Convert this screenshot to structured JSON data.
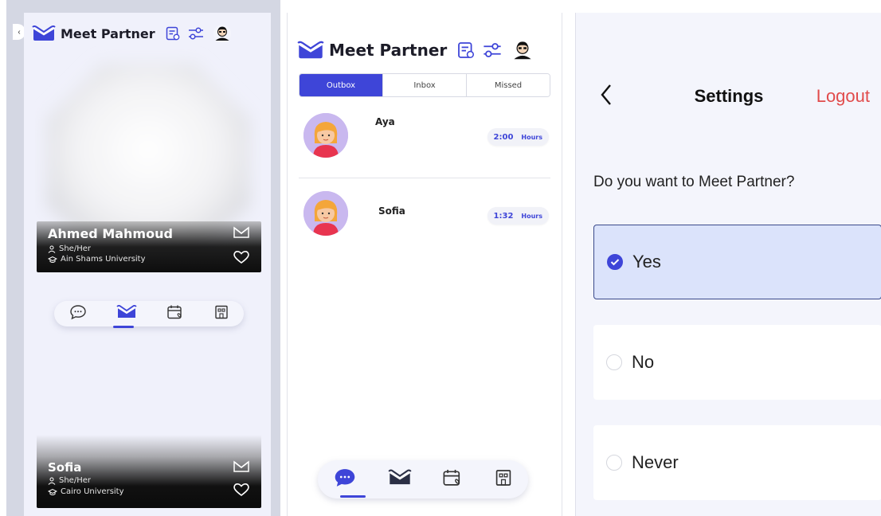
{
  "app": {
    "brand": "Meet Partner"
  },
  "colors": {
    "accent": "#3e45d8",
    "logout": "#e14b4b",
    "selected_option_bg": "#dbe3fb"
  },
  "discover": {
    "back_arrow": "‹",
    "cards": [
      {
        "name": "Ahmed Mahmoud",
        "pronouns": "She/Her",
        "university": "Ain Shams University"
      },
      {
        "name": "Sofia",
        "pronouns": "She/Her",
        "university": "Cairo University"
      }
    ],
    "nav_icons": [
      "chat-icon",
      "mail-logo-icon",
      "calendar-icon",
      "building-icon"
    ],
    "active_nav": 1
  },
  "requests": {
    "tabs": [
      {
        "label": "Outbox",
        "active": true
      },
      {
        "label": "Inbox",
        "active": false
      },
      {
        "label": "Missed",
        "active": false
      }
    ],
    "items": [
      {
        "name": "Aya",
        "time": "2:00",
        "unit": "Hours"
      },
      {
        "name": "Sofia",
        "time": "1:32",
        "unit": "Hours"
      }
    ],
    "nav_icons": [
      "chat-icon",
      "mail-logo-icon",
      "calendar-icon",
      "building-icon"
    ],
    "active_nav": 0
  },
  "settings": {
    "back": "‹",
    "title": "Settings",
    "logout_label": "Logout",
    "question": "Do you want to Meet Partner?",
    "options": [
      {
        "label": "Yes",
        "selected": true
      },
      {
        "label": "No",
        "selected": false
      },
      {
        "label": "Never",
        "selected": false
      }
    ]
  }
}
